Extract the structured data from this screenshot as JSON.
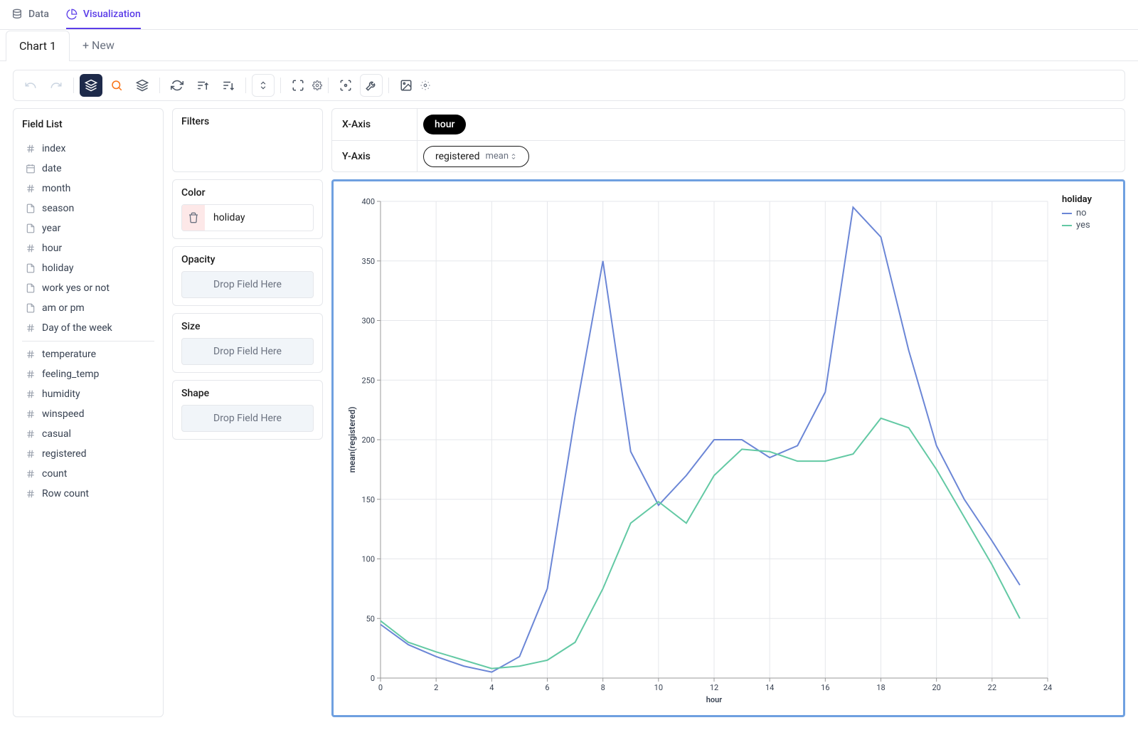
{
  "topnav": {
    "data_label": "Data",
    "viz_label": "Visualization"
  },
  "tabs": {
    "active": "Chart 1",
    "new_label": "+ New"
  },
  "fieldlist": {
    "title": "Field List",
    "items": [
      {
        "icon": "hash",
        "label": "index"
      },
      {
        "icon": "date",
        "label": "date"
      },
      {
        "icon": "hash",
        "label": "month"
      },
      {
        "icon": "doc",
        "label": "season"
      },
      {
        "icon": "doc",
        "label": "year"
      },
      {
        "icon": "hash",
        "label": "hour"
      },
      {
        "icon": "doc",
        "label": "holiday"
      },
      {
        "icon": "doc",
        "label": "work yes or not"
      },
      {
        "icon": "doc",
        "label": "am or pm"
      },
      {
        "icon": "hash",
        "label": "Day of the week"
      },
      {
        "sep": true
      },
      {
        "icon": "hash",
        "label": "temperature"
      },
      {
        "icon": "hash",
        "label": "feeling_temp"
      },
      {
        "icon": "hash",
        "label": "humidity"
      },
      {
        "icon": "hash",
        "label": "winspeed"
      },
      {
        "icon": "hash",
        "label": "casual"
      },
      {
        "icon": "hash",
        "label": "registered"
      },
      {
        "icon": "hash",
        "label": "count"
      },
      {
        "icon": "hash",
        "label": "Row count"
      }
    ]
  },
  "shelves": {
    "filters_title": "Filters",
    "color_title": "Color",
    "color_field": "holiday",
    "opacity_title": "Opacity",
    "size_title": "Size",
    "shape_title": "Shape",
    "drop_placeholder": "Drop Field Here"
  },
  "axes": {
    "x_label": "X-Axis",
    "x_field": "hour",
    "y_label": "Y-Axis",
    "y_field": "registered",
    "y_agg": "mean"
  },
  "chart_data": {
    "type": "line",
    "title": "",
    "xlabel": "hour",
    "ylabel": "mean(registered)",
    "xlim": [
      0,
      24
    ],
    "ylim": [
      0,
      400
    ],
    "x": [
      0,
      1,
      2,
      3,
      4,
      5,
      6,
      7,
      8,
      9,
      10,
      11,
      12,
      13,
      14,
      15,
      16,
      17,
      18,
      19,
      20,
      21,
      22,
      23
    ],
    "legend_title": "holiday",
    "series": [
      {
        "name": "no",
        "color": "#6b86d6",
        "values": [
          45,
          28,
          18,
          10,
          5,
          18,
          75,
          220,
          350,
          190,
          145,
          170,
          200,
          200,
          185,
          195,
          240,
          395,
          370,
          275,
          195,
          150,
          115,
          78
        ]
      },
      {
        "name": "yes",
        "color": "#63c9a4",
        "values": [
          48,
          30,
          22,
          15,
          8,
          10,
          15,
          30,
          75,
          130,
          148,
          130,
          170,
          192,
          190,
          182,
          182,
          188,
          218,
          210,
          175,
          135,
          95,
          50
        ]
      }
    ]
  }
}
